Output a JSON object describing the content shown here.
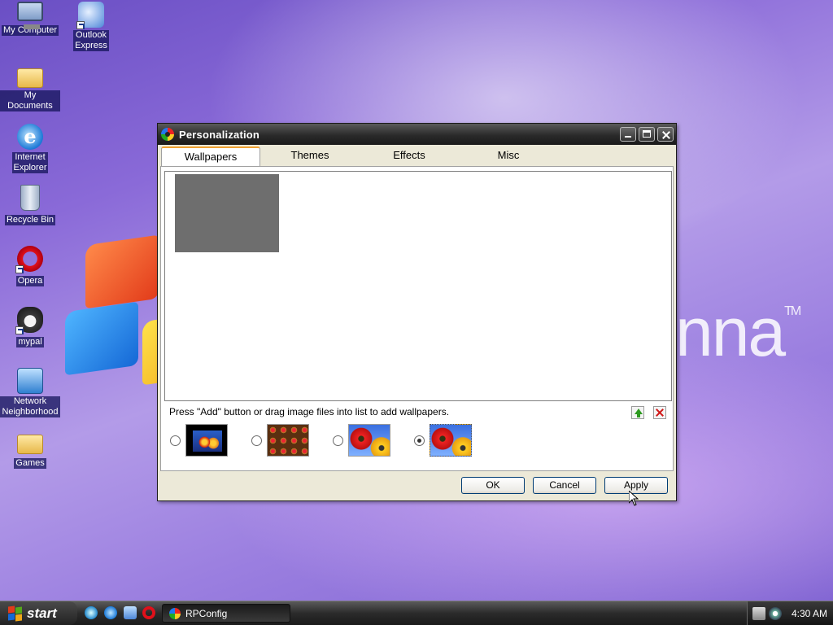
{
  "desktop": {
    "icons": [
      {
        "label_lines": [
          "My Computer"
        ],
        "icon": "computer-icon"
      },
      {
        "label_lines": [
          "Outlook",
          "Express"
        ],
        "icon": "outlook-express-icon"
      },
      {
        "label_lines": [
          "My Documents"
        ],
        "icon": "documents-folder-icon"
      },
      {
        "label_lines": [
          "Internet",
          "Explorer"
        ],
        "icon": "internet-explorer-icon"
      },
      {
        "label_lines": [
          "Recycle Bin"
        ],
        "icon": "recycle-bin-icon"
      },
      {
        "label_lines": [
          "Opera"
        ],
        "icon": "opera-icon"
      },
      {
        "label_lines": [
          "mypal"
        ],
        "icon": "mypal-icon"
      },
      {
        "label_lines": [
          "Network",
          "Neighborhood"
        ],
        "icon": "network-icon"
      },
      {
        "label_lines": [
          "Games"
        ],
        "icon": "games-folder-icon"
      }
    ],
    "brand_text": "nna",
    "brand_mark": "TM"
  },
  "window": {
    "title": "Personalization",
    "tabs": [
      {
        "label": "Wallpapers",
        "active": true
      },
      {
        "label": "Themes",
        "active": false
      },
      {
        "label": "Effects",
        "active": false
      },
      {
        "label": "Misc",
        "active": false
      }
    ],
    "hint": "Press \"Add\" button or drag image files into list to add wallpapers.",
    "fit_options": [
      {
        "selected": false,
        "icon": "centered-wallpaper-icon"
      },
      {
        "selected": false,
        "icon": "tiled-wallpaper-icon"
      },
      {
        "selected": false,
        "icon": "stretched-wallpaper-icon"
      },
      {
        "selected": true,
        "icon": "fill-wallpaper-icon"
      }
    ],
    "buttons": {
      "ok": "OK",
      "cancel": "Cancel",
      "apply": "Apply"
    }
  },
  "taskbar": {
    "start_label": "start",
    "task_label": "RPConfig",
    "clock": "4:30 AM"
  },
  "colors": {
    "titlebar": "#2a2a2a",
    "window_bg": "#ece9d8",
    "tab_accent": "#f0a030",
    "taskbar": "#2b2b2b"
  }
}
